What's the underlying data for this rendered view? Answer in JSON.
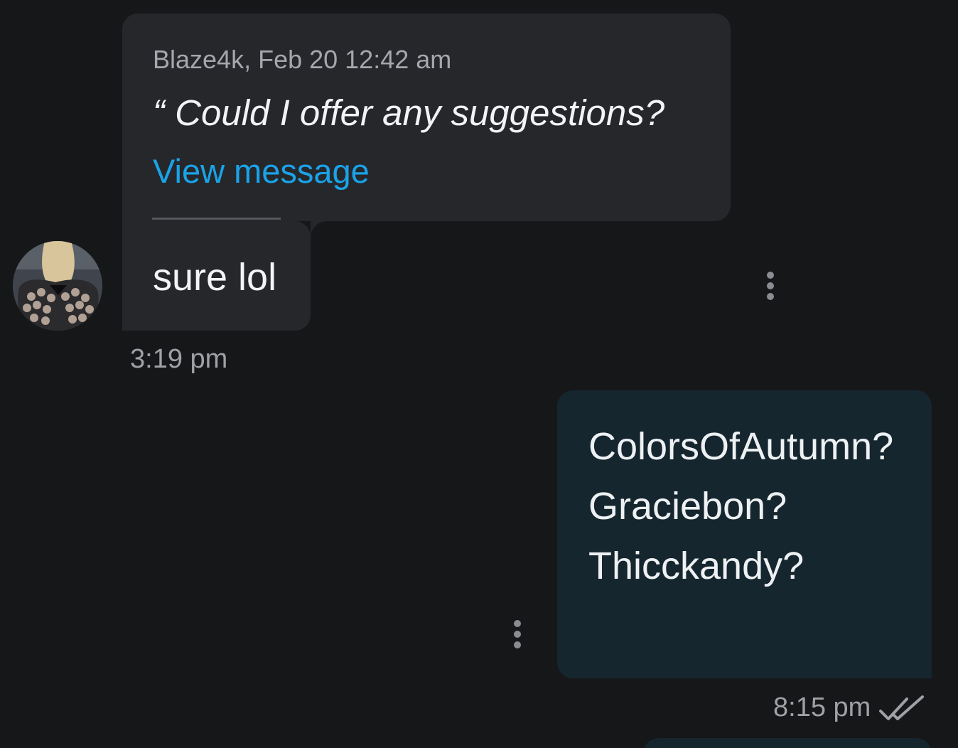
{
  "incoming": {
    "quote": {
      "meta": "Blaze4k, Feb 20 12:42 am",
      "text": "“ Could I offer any suggestions?",
      "link_label": "View message"
    },
    "message": "sure lol",
    "time": "3:19 pm"
  },
  "outgoing": {
    "lines": [
      "ColorsOfAutumn?",
      "Graciebon?",
      "Thicckandy?"
    ],
    "time": "8:15 pm",
    "status_icon": "double-check-icon"
  },
  "icons": {
    "more": "more-vertical-icon",
    "avatar": "avatar"
  },
  "colors": {
    "background": "#161719",
    "incoming_bubble": "#26272b",
    "outgoing_bubble": "#15262f",
    "link": "#1aa3e8",
    "muted_text": "#9fa1a7"
  }
}
